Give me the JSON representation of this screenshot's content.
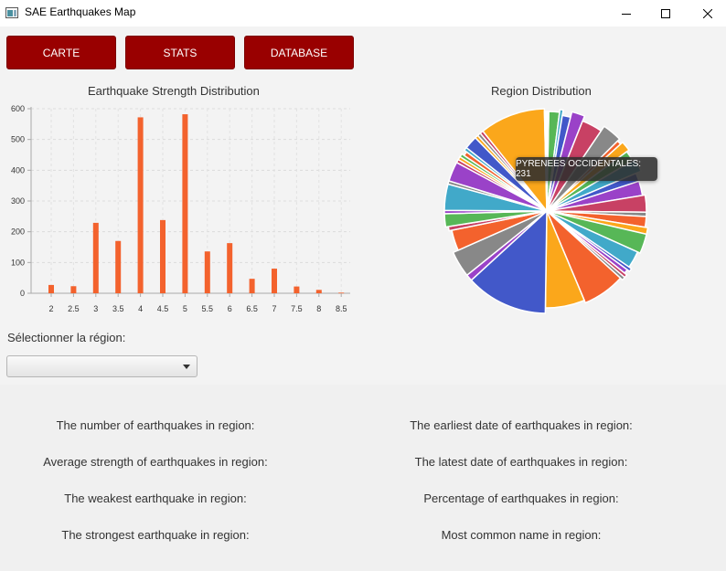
{
  "window": {
    "title": "SAE Earthquakes Map"
  },
  "nav": {
    "carte": "CARTE",
    "stats": "STATS",
    "database": "DATABASE"
  },
  "bar_chart_title": "Earthquake Strength Distribution",
  "pie_chart_title": "Region Distribution",
  "tooltip": "PYRENEES OCCIDENTALES: 231",
  "region_select": {
    "label": "Sélectionner la région:",
    "value": ""
  },
  "stats": {
    "count": "The number of earthquakes in region:",
    "average": "Average strength of earthquakes in region:",
    "weakest": "The weakest earthquake in region:",
    "strongest": "The strongest earthquake in region:",
    "earliest": "The earliest date of earthquakes in region:",
    "latest": "The latest date of earthquakes in region:",
    "percentage": "Percentage of earthquakes in region:",
    "common_name": "Most common name in region:"
  },
  "colors": {
    "bar": "#f3622d",
    "nav_button": "#990000"
  },
  "chart_data": [
    {
      "type": "bar",
      "title": "Earthquake Strength Distribution",
      "categories": [
        "2",
        "2.5",
        "3",
        "3.5",
        "4",
        "4.5",
        "5",
        "5.5",
        "6",
        "6.5",
        "7",
        "7.5",
        "8",
        "8.5"
      ],
      "values": [
        27,
        23,
        229,
        170,
        572,
        238,
        582,
        136,
        163,
        47,
        80,
        22,
        11,
        2
      ],
      "ylim": [
        0,
        600
      ],
      "yticks": [
        0,
        100,
        200,
        300,
        400,
        500,
        600
      ],
      "grid": true,
      "legend": "none"
    },
    {
      "type": "pie",
      "title": "Region Distribution",
      "slices": [
        {
          "value": 10,
          "color": "#57b757"
        },
        {
          "value": 3,
          "color": "#41a9c9"
        },
        {
          "value": 8,
          "color": "#4258c9"
        },
        {
          "value": 12,
          "color": "#9a42c8"
        },
        {
          "value": 20,
          "color": "#c84164"
        },
        {
          "value": 18,
          "color": "#888888"
        },
        {
          "value": 4,
          "color": "#f3622d"
        },
        {
          "value": 9,
          "color": "#fba71b"
        },
        {
          "value": 10,
          "color": "#57b757"
        },
        {
          "value": 12,
          "color": "#41a9c9"
        },
        {
          "value": 8,
          "color": "#4258c9"
        },
        {
          "value": 14,
          "color": "#9a42c8"
        },
        {
          "value": 16,
          "color": "#c84164"
        },
        {
          "value": 4,
          "color": "#888888"
        },
        {
          "value": 10,
          "color": "#f3622d"
        },
        {
          "value": 6,
          "color": "#fba71b"
        },
        {
          "value": 18,
          "color": "#57b757"
        },
        {
          "value": 16,
          "color": "#41a9c9"
        },
        {
          "value": 3,
          "color": "#4258c9"
        },
        {
          "value": 4,
          "color": "#9a42c8"
        },
        {
          "value": 3,
          "color": "#c84164"
        },
        {
          "value": 3,
          "color": "#888888"
        },
        {
          "value": 40,
          "color": "#f3622d"
        },
        {
          "value": 38,
          "color": "#fba71b"
        },
        {
          "value": 75,
          "color": "#4258c9"
        },
        {
          "value": 6,
          "color": "#9a42c8"
        },
        {
          "value": 24,
          "color": "#888888"
        },
        {
          "value": 20,
          "color": "#f3622d"
        },
        {
          "value": 4,
          "color": "#c84164"
        },
        {
          "value": 12,
          "color": "#57b757"
        },
        {
          "value": 3,
          "color": "#9a42c8"
        },
        {
          "value": 24,
          "color": "#41a9c9"
        },
        {
          "value": 3,
          "color": "#888888"
        },
        {
          "value": 18,
          "color": "#9a42c8"
        },
        {
          "value": 3,
          "color": "#c84164"
        },
        {
          "value": 3,
          "color": "#fba71b"
        },
        {
          "value": 3,
          "color": "#57b757"
        },
        {
          "value": 4,
          "color": "#f3622d"
        },
        {
          "value": 3,
          "color": "#41a9c9"
        },
        {
          "value": 12,
          "color": "#4258c9"
        },
        {
          "value": 3,
          "color": "#fba71b"
        },
        {
          "value": 3,
          "color": "#888888"
        },
        {
          "value": 3,
          "color": "#c84164"
        },
        {
          "value": 60,
          "color": "#fba71b"
        },
        {
          "value": 4,
          "color": "#ffffff"
        }
      ]
    }
  ]
}
